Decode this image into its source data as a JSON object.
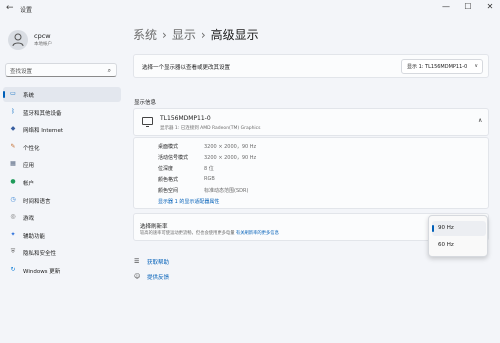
{
  "titlebar": {
    "back": "←",
    "title": "设置",
    "min": "—",
    "max": "☐",
    "close": "✕"
  },
  "user": {
    "name": "cpcw",
    "account": "本地帐户"
  },
  "search": {
    "placeholder": "查找设置"
  },
  "sidebar": {
    "items": [
      {
        "label": "系统",
        "icon": "monitor-icon",
        "color": "#0067c0",
        "active": true
      },
      {
        "label": "蓝牙和其他设备",
        "icon": "bluetooth-icon",
        "color": "#0067c0"
      },
      {
        "label": "网络和 Internet",
        "icon": "wifi-icon",
        "color": "#3a5fa0"
      },
      {
        "label": "个性化",
        "icon": "brush-icon",
        "color": "#c26a2b"
      },
      {
        "label": "应用",
        "icon": "apps-icon",
        "color": "#5a6a84"
      },
      {
        "label": "帐户",
        "icon": "person-icon",
        "color": "#1f9b5a"
      },
      {
        "label": "时间和语言",
        "icon": "globe-clock-icon",
        "color": "#2d7dd2"
      },
      {
        "label": "游戏",
        "icon": "gamepad-icon",
        "color": "#6b6b6b"
      },
      {
        "label": "辅助功能",
        "icon": "accessibility-icon",
        "color": "#2a6fdb"
      },
      {
        "label": "隐私和安全性",
        "icon": "shield-icon",
        "color": "#6b6b6b"
      },
      {
        "label": "Windows 更新",
        "icon": "update-icon",
        "color": "#0a7bd7"
      }
    ]
  },
  "breadcrumb": {
    "part1": "系统",
    "part2": "显示",
    "current": "高级显示",
    "sep": "›"
  },
  "select_display": {
    "label": "选择一个显示器以查看或更改其设置",
    "value": "显示 1: TL156MDMP11-0"
  },
  "display_info": {
    "section": "显示信息",
    "monitor_name": "TL156MDMP11-0",
    "monitor_sub": "显示器 1: 已连接到 AMD Radeon(TM) Graphics",
    "rows": [
      {
        "key": "桌面模式",
        "value": "3200 × 2000，90 Hz"
      },
      {
        "key": "活动信号模式",
        "value": "3200 × 2000，90 Hz"
      },
      {
        "key": "位深度",
        "value": "8 位"
      },
      {
        "key": "颜色格式",
        "value": "RGB"
      },
      {
        "key": "颜色空间",
        "value": "标准动态范围(SDR)"
      }
    ],
    "adapter_link": "显示器 1 的显示适配器属性"
  },
  "refresh": {
    "title": "选择刷新率",
    "desc": "较高的速率可使运动更流畅，但也会使用更多电量",
    "desc_link": "有关刷新率的更多信息",
    "options": [
      "90 Hz",
      "60 Hz"
    ],
    "selected": "90 Hz"
  },
  "help": {
    "get_help": "获取帮助",
    "feedback": "提供反馈"
  },
  "colors": {
    "accent": "#005fb8",
    "background": "#f3f5f9",
    "card": "#fbfcfd"
  }
}
